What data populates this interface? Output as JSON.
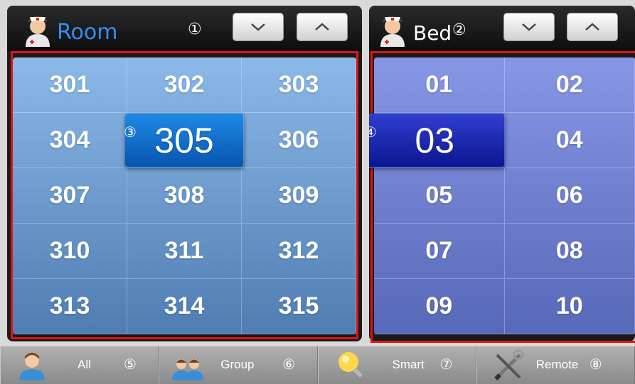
{
  "room_panel": {
    "title": "Room",
    "marker": "①"
  },
  "bed_panel": {
    "title": "Bed",
    "marker": "②"
  },
  "rooms": [
    "301",
    "302",
    "303",
    "304",
    "305",
    "306",
    "307",
    "308",
    "309",
    "310",
    "311",
    "312",
    "313",
    "314",
    "315"
  ],
  "selected_room": "305",
  "selected_room_marker": "③",
  "beds": [
    "01",
    "02",
    "03",
    "04",
    "05",
    "06",
    "07",
    "08",
    "09",
    "10"
  ],
  "selected_bed": "03",
  "selected_bed_marker": "④",
  "bottom_bar": [
    {
      "label": "All",
      "marker": "⑤",
      "icon": "person-icon"
    },
    {
      "label": "Group",
      "marker": "⑥",
      "icon": "group-icon"
    },
    {
      "label": "Smart",
      "marker": "⑦",
      "icon": "lightbulb-icon"
    },
    {
      "label": "Remote",
      "marker": "⑧",
      "icon": "tools-icon"
    }
  ],
  "colors": {
    "room_title": "#2f8ff0",
    "highlight_box": "#e31212",
    "selected_room": "#1470d4",
    "selected_bed": "#1a23a8"
  }
}
